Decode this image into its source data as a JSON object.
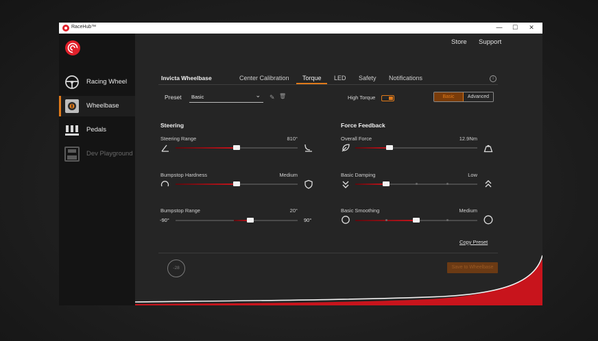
{
  "window": {
    "title": "RaceHub™",
    "controls": [
      "—",
      "☐",
      "✕"
    ]
  },
  "sidebar": {
    "items": [
      {
        "label": "Racing Wheel",
        "icon": "steering-wheel-icon"
      },
      {
        "label": "Wheelbase",
        "icon": "wheelbase-icon"
      },
      {
        "label": "Pedals",
        "icon": "pedals-icon"
      },
      {
        "label": "Dev Playground",
        "icon": "dev-playground-icon"
      }
    ]
  },
  "topnav": {
    "store": "Store",
    "support": "Support"
  },
  "tabs": {
    "device_title": "Invicta Wheelbase",
    "items": [
      "Center Calibration",
      "Torque",
      "LED",
      "Safety",
      "Notifications"
    ],
    "active": "Torque"
  },
  "preset": {
    "label": "Preset",
    "value": "Basic"
  },
  "high_torque": {
    "label": "High Torque",
    "enabled": true
  },
  "mode": {
    "basic": "Basic",
    "advanced": "Advanced",
    "selected": "Basic"
  },
  "steering": {
    "title": "Steering",
    "range": {
      "label": "Steering Range",
      "value": "810°",
      "level": 0.5
    },
    "bumpstop_hardness": {
      "label": "Bumpstop Hardness",
      "value": "Medium",
      "level": 0.5
    },
    "bumpstop_range": {
      "label": "Bumpstop Range",
      "value": "20°",
      "min": "-90°",
      "max": "90°",
      "level": 0.61
    }
  },
  "force_feedback": {
    "title": "Force Feedback",
    "overall_force": {
      "label": "Overall Force",
      "value": "12.9Nm",
      "level": 0.28
    },
    "basic_damping": {
      "label": "Basic Damping",
      "value": "Low",
      "level": 0.25
    },
    "basic_smoothing": {
      "label": "Basic Smoothing",
      "value": "Medium",
      "level": 0.5
    }
  },
  "copy_preset": "Copy Preset",
  "footer": {
    "badge": "-28",
    "save": "Save to Wheelbase"
  },
  "colors": {
    "accent": "#e07a1a",
    "brand_red": "#e0202a",
    "slider_fill": "#c8141c"
  }
}
